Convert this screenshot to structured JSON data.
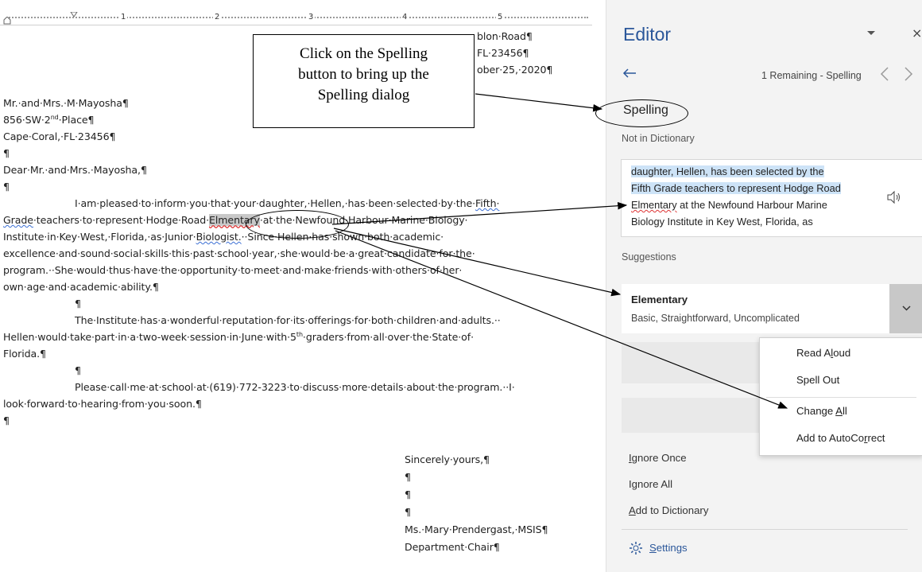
{
  "ruler": {
    "numbers": [
      "1",
      "2",
      "3",
      "4",
      "5"
    ]
  },
  "document": {
    "address_partial": [
      "blon·Road¶",
      "FL·23456¶",
      "ober·25,·2020¶"
    ],
    "recipient": [
      "Mr.·and·Mrs.·M·Mayosha¶",
      "856·SW·2",
      "nd",
      "·Place¶",
      "Cape·Coral,·FL·23456¶",
      "¶",
      "Dear·Mr.·and·Mrs.·Mayosha,¶",
      "¶"
    ],
    "p1": {
      "l1a": "I·am·pleased·to·inform·you·that·your·daughter,·Hellen,·has·been·selected·by·the·",
      "l1b": "Fifth·",
      "l2a": "Grade",
      "l2b": "·teachers·to·represent·Hodge·Road·",
      "l2c": "Elmentary",
      "l2d": "·at·the·Newfound·Harbour·Marine·Biology·",
      "l3a": "Institute·in·Key·West,·Florida,·as·Junior·",
      "l3b": "Biologist.",
      "l3c": "··Since·Hellen·has·shown·both·academic·",
      "l4": "excellence·and·sound·social·skills·this·past·school·year,·she·would·be·a·great·candidate·for·the·",
      "l5": "program.··She·would·thus·have·the·opportunity·to·meet·and·make·friends·with·others·of·her·",
      "l6": "own·age·and·academic·ability.¶"
    },
    "pilcrow1": "¶",
    "p2": {
      "l1": "The·Institute·has·a·wonderful·reputation·for·its·offerings·for·both·children·and·adults.··",
      "l2a": "Hellen·would·take·part·in·a·two-week·session·in·June·with·5",
      "l2sup": "th",
      "l2b": "·graders·from·all·over·the·State·of·",
      "l3": "Florida.¶"
    },
    "pilcrow2": "¶",
    "p3": {
      "l1": "Please·call·me·at·school·at·(619)·772-3223·to·discuss·more·details·about·the·program.··I·",
      "l2": "look·forward·to·hearing·from·you·soon.¶",
      "l3": "¶"
    },
    "signature": [
      "Sincerely·yours,¶",
      "¶",
      "¶",
      "¶",
      "Ms.·Mary·Prendergast,·MSIS¶",
      "Department·Chair¶"
    ]
  },
  "callout": {
    "lines": [
      "Click on the Spelling",
      "button to bring up the",
      "Spelling dialog"
    ]
  },
  "editor": {
    "title": "Editor",
    "dropdown_icon": "caret-down-icon",
    "back_icon": "arrow-left-icon",
    "remaining": "1 Remaining - Spelling",
    "section": "Spelling",
    "not_in_dict": "Not in Dictionary",
    "context": {
      "l1": "daughter, Hellen, has been selected by the",
      "l2": "Fifth Grade teachers to represent Hodge Road",
      "l3a": "Elmentary",
      "l3b": " at the Newfound Harbour Marine",
      "l4": "Biology Institute in Key West, Florida, as"
    },
    "suggestions_label": "Suggestions",
    "suggestion": {
      "word": "Elementary",
      "synonyms": "Basic, Straightforward, Uncomplicated"
    },
    "actions": [
      {
        "pre": "",
        "u": "I",
        "post": "gnore Once"
      },
      {
        "pre": "I",
        "u": "g",
        "post": "nore All"
      },
      {
        "pre": "",
        "u": "A",
        "post": "dd to Dictionary"
      }
    ],
    "settings": {
      "u": "S",
      "post": "ettings"
    }
  },
  "context_menu": [
    {
      "pre": "Read A",
      "u": "l",
      "post": "oud"
    },
    {
      "pre": "Spell Out",
      "u": "",
      "post": ""
    },
    {
      "pre": "Change ",
      "u": "A",
      "post": "ll"
    },
    {
      "pre": "Add to AutoCo",
      "u": "r",
      "post": "rect"
    }
  ],
  "colors": {
    "accent": "#2b579a",
    "selection": "#cde3f7",
    "pane": "#f3f3f3"
  }
}
